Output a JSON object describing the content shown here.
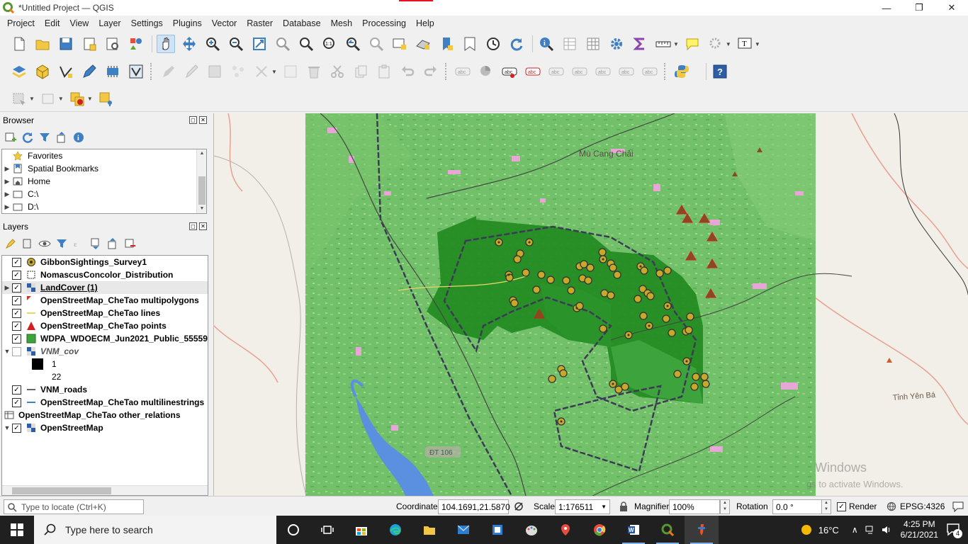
{
  "window": {
    "title": "*Untitled Project — QGIS",
    "controls": [
      "—",
      "❐",
      "✕"
    ]
  },
  "menu": [
    "Project",
    "Edit",
    "View",
    "Layer",
    "Settings",
    "Plugins",
    "Vector",
    "Raster",
    "Database",
    "Mesh",
    "Processing",
    "Help"
  ],
  "browser": {
    "title": "Browser",
    "items": [
      {
        "label": "Favorites",
        "icon": "star-icon"
      },
      {
        "label": "Spatial Bookmarks",
        "icon": "bookmark-icon"
      },
      {
        "label": "Home",
        "icon": "home-folder-icon"
      },
      {
        "label": "C:\\",
        "icon": "drive-icon"
      },
      {
        "label": "D:\\",
        "icon": "drive-icon"
      }
    ]
  },
  "layers": {
    "title": "Layers",
    "items": [
      {
        "label": "GibbonSightings_Survey1",
        "checked": true,
        "symbol": "point-yellow"
      },
      {
        "label": "NomascusConcolor_Distribution",
        "checked": true,
        "symbol": "polygon-outline"
      },
      {
        "label": "LandCover (1)",
        "checked": true,
        "symbol": "raster",
        "expanded": false
      },
      {
        "label": "OpenStreetMap_CheTao multipolygons",
        "checked": true,
        "symbol": "polygon-dark"
      },
      {
        "label": "OpenStreetMap_CheTao lines",
        "checked": true,
        "symbol": "line-yellow"
      },
      {
        "label": "OpenStreetMap_CheTao points",
        "checked": true,
        "symbol": "triangle-red"
      },
      {
        "label": "WDPA_WDOECM_Jun2021_Public_555594",
        "checked": true,
        "symbol": "fill-green"
      },
      {
        "label": "VNM_cov",
        "checked": false,
        "symbol": "raster",
        "expanded": true
      },
      {
        "label": "1",
        "legend": true,
        "swatch": "#000000"
      },
      {
        "label": "22",
        "legend": true,
        "swatch": "#ffffff"
      },
      {
        "label": "VNM_roads",
        "checked": true,
        "symbol": "line-dark"
      },
      {
        "label": "OpenStreetMap_CheTao multilinestrings",
        "checked": true,
        "symbol": "line-blue"
      },
      {
        "label": "OpenStreetMap_CheTao other_relations",
        "checked": null,
        "symbol": "table"
      },
      {
        "label": "OpenStreetMap",
        "checked": true,
        "symbol": "raster",
        "expanded": true
      }
    ]
  },
  "map": {
    "labels": [
      "Mù Cang Chải",
      "Tỉnh Yên Bá",
      "ĐT 106",
      "Windows",
      "gs to activate Windows."
    ],
    "colors": {
      "background": "#f2efe9",
      "landcover": "#72c06a",
      "protected_area": "#2f9a2f",
      "water": "#5b8fe0"
    }
  },
  "status": {
    "locate_placeholder": "Type to locate (Ctrl+K)",
    "coordinate_label": "Coordinate",
    "coordinate": "104.1691,21.5870",
    "scale_label": "Scale",
    "scale": "1:176511",
    "magnifier_label": "Magnifier",
    "magnifier": "100%",
    "rotation_label": "Rotation",
    "rotation": "0.0 °",
    "render_label": "Render",
    "crs": "EPSG:4326"
  },
  "taskbar": {
    "search_placeholder": "Type here to search",
    "weather": "16°C",
    "time": "4:25 PM",
    "date": "6/21/2021",
    "notifications": "4"
  }
}
